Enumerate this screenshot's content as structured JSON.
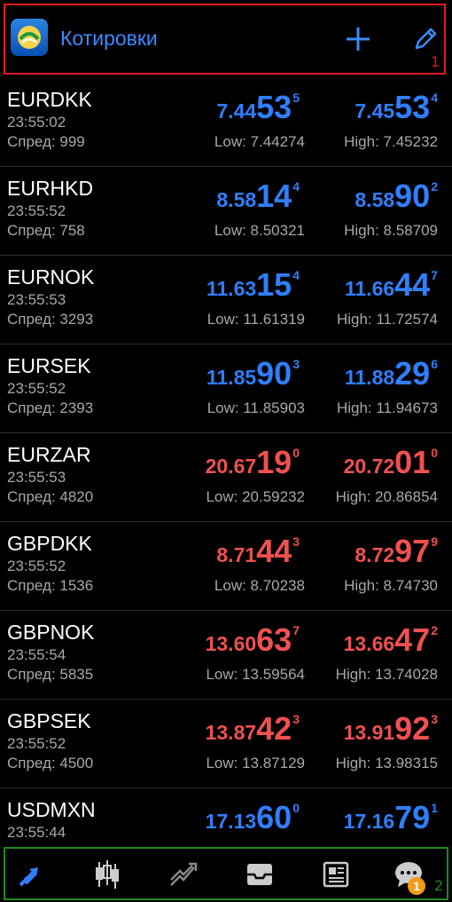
{
  "header": {
    "title": "Котировки",
    "annotation_number": "1",
    "icons": [
      "app-logo-icon",
      "plus-icon",
      "pencil-icon"
    ]
  },
  "quotes": [
    {
      "symbol": "EURDKK",
      "time": "23:55:02",
      "spread": "Спред: 999",
      "bid": {
        "pre": "7.44",
        "big": "53",
        "sup": "5"
      },
      "ask": {
        "pre": "7.45",
        "big": "53",
        "sup": "4"
      },
      "low": "Low: 7.44274",
      "high": "High: 7.45232",
      "direction": "blue"
    },
    {
      "symbol": "EURHKD",
      "time": "23:55:52",
      "spread": "Спред: 758",
      "bid": {
        "pre": "8.58",
        "big": "14",
        "sup": "4"
      },
      "ask": {
        "pre": "8.58",
        "big": "90",
        "sup": "2"
      },
      "low": "Low: 8.50321",
      "high": "High: 8.58709",
      "direction": "blue"
    },
    {
      "symbol": "EURNOK",
      "time": "23:55:53",
      "spread": "Спред: 3293",
      "bid": {
        "pre": "11.63",
        "big": "15",
        "sup": "4"
      },
      "ask": {
        "pre": "11.66",
        "big": "44",
        "sup": "7"
      },
      "low": "Low: 11.61319",
      "high": "High: 11.72574",
      "direction": "blue"
    },
    {
      "symbol": "EURSEK",
      "time": "23:55:52",
      "spread": "Спред: 2393",
      "bid": {
        "pre": "11.85",
        "big": "90",
        "sup": "3"
      },
      "ask": {
        "pre": "11.88",
        "big": "29",
        "sup": "6"
      },
      "low": "Low: 11.85903",
      "high": "High: 11.94673",
      "direction": "blue"
    },
    {
      "symbol": "EURZAR",
      "time": "23:55:53",
      "spread": "Спред: 4820",
      "bid": {
        "pre": "20.67",
        "big": "19",
        "sup": "0"
      },
      "ask": {
        "pre": "20.72",
        "big": "01",
        "sup": "0"
      },
      "low": "Low: 20.59232",
      "high": "High: 20.86854",
      "direction": "red"
    },
    {
      "symbol": "GBPDKK",
      "time": "23:55:52",
      "spread": "Спред: 1536",
      "bid": {
        "pre": "8.71",
        "big": "44",
        "sup": "3"
      },
      "ask": {
        "pre": "8.72",
        "big": "97",
        "sup": "9"
      },
      "low": "Low: 8.70238",
      "high": "High: 8.74730",
      "direction": "red"
    },
    {
      "symbol": "GBPNOK",
      "time": "23:55:54",
      "spread": "Спред: 5835",
      "bid": {
        "pre": "13.60",
        "big": "63",
        "sup": "7"
      },
      "ask": {
        "pre": "13.66",
        "big": "47",
        "sup": "2"
      },
      "low": "Low: 13.59564",
      "high": "High: 13.74028",
      "direction": "red"
    },
    {
      "symbol": "GBPSEK",
      "time": "23:55:52",
      "spread": "Спред: 4500",
      "bid": {
        "pre": "13.87",
        "big": "42",
        "sup": "3"
      },
      "ask": {
        "pre": "13.91",
        "big": "92",
        "sup": "3"
      },
      "low": "Low: 13.87129",
      "high": "High: 13.98315",
      "direction": "red"
    },
    {
      "symbol": "USDMXN",
      "time": "23:55:44",
      "spread": "",
      "bid": {
        "pre": "17.13",
        "big": "60",
        "sup": "0"
      },
      "ask": {
        "pre": "17.16",
        "big": "79",
        "sup": "1"
      },
      "low": "",
      "high": "",
      "direction": "blue"
    }
  ],
  "bottom_nav": {
    "items": [
      "quotes-icon",
      "chart-icon",
      "trade-icon",
      "history-icon",
      "news-icon",
      "chat-icon"
    ],
    "badge": "1",
    "annotation_number": "2"
  },
  "colors": {
    "blue": "#2f7fff",
    "red": "#f05050",
    "highlight_red": "#e21b1b",
    "highlight_green": "#1f8a1f",
    "badge": "#f39a16"
  }
}
